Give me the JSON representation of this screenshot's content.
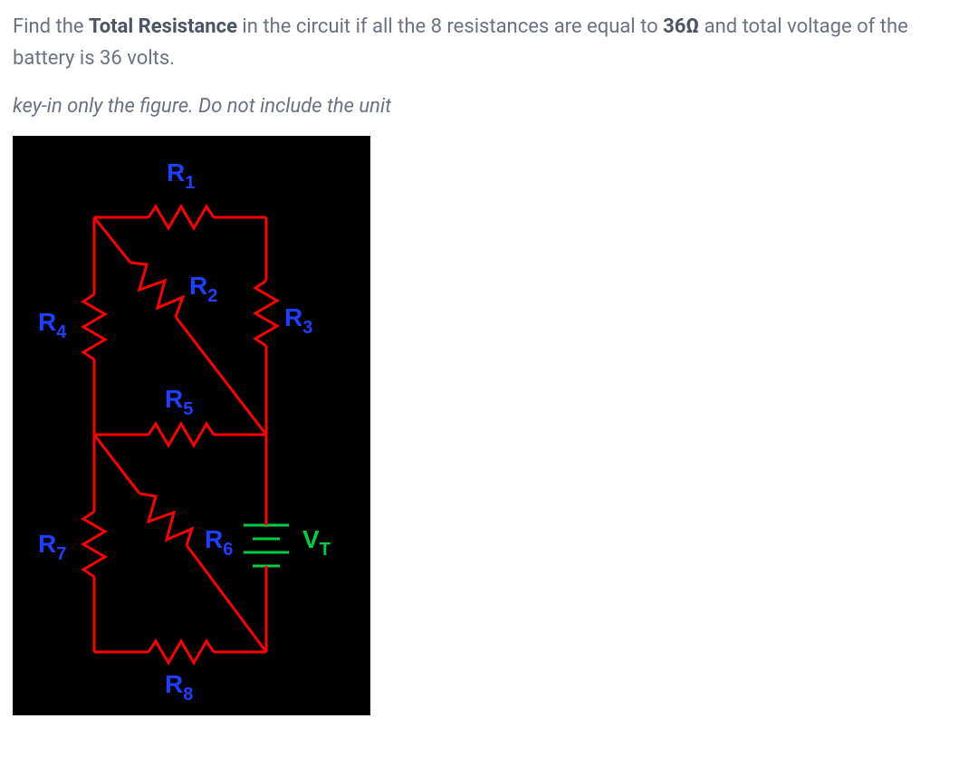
{
  "problem": {
    "prefix": "Find the ",
    "bold": "Total Resistance",
    "mid1": " in the circuit if all the 8 resistances are equal to ",
    "value": "36Ω",
    "mid2": " and total voltage of the battery is 36 volts."
  },
  "instruction": "key-in only the figure. Do not include the unit",
  "circuit": {
    "labels": {
      "r1": "R",
      "r1_sub": "1",
      "r2": "R",
      "r2_sub": "2",
      "r3": "R",
      "r3_sub": "3",
      "r4": "R",
      "r4_sub": "4",
      "r5": "R",
      "r5_sub": "5",
      "r6": "R",
      "r6_sub": "6",
      "r7": "R",
      "r7_sub": "7",
      "r8": "R",
      "r8_sub": "8",
      "vt": "V",
      "vt_sub": "T"
    }
  }
}
